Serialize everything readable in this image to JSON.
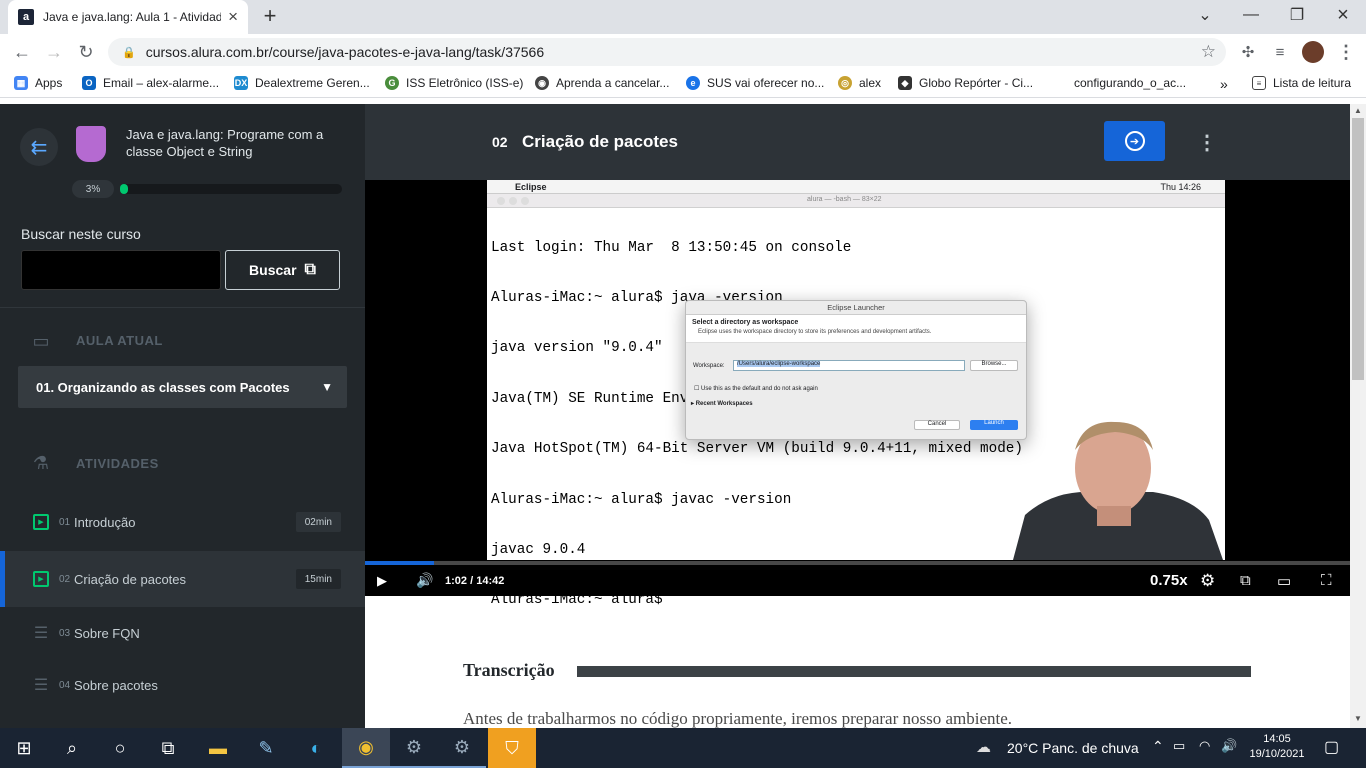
{
  "browser": {
    "tab_title": "Java e java.lang: Aula 1 - Atividad",
    "favicon_letter": "a",
    "url": "cursos.alura.com.br/course/java-pacotes-e-java-lang/task/37566",
    "bookmarks": [
      {
        "label": "Apps",
        "icon": "apps-grid-icon",
        "color": "#4285f4"
      },
      {
        "label": "Email – alex-alarme...",
        "icon": "outlook-icon",
        "color": "#0a64c2"
      },
      {
        "label": "Dealextreme Geren...",
        "icon": "dx-icon",
        "color": "#1e8bd0"
      },
      {
        "label": "ISS Eletrônico (ISS-e)",
        "icon": "globe-icon",
        "color": "#4a8d3c"
      },
      {
        "label": "Aprenda a cancelar...",
        "icon": "globe-icon",
        "color": "#444444"
      },
      {
        "label": "SUS vai oferecer no...",
        "icon": "globe-icon",
        "color": "#1a73e8"
      },
      {
        "label": "alex",
        "icon": "coin-icon",
        "color": "#c8a232"
      },
      {
        "label": "Globo Repórter - Ci...",
        "icon": "globo-icon",
        "color": "#333333"
      },
      {
        "label": "configurando_o_ac...",
        "icon": "",
        "color": ""
      }
    ],
    "reading_list": "Lista de leitura"
  },
  "sidebar": {
    "course_title": "Java e java.lang: Programe com a classe Object e String",
    "progress_label": "3%",
    "progress_value": 0.03,
    "search_label": "Buscar neste curso",
    "search_placeholder": "",
    "search_button": "Buscar",
    "current_lesson_heading": "AULA ATUAL",
    "current_lesson": "01. Organizando as classes com Pacotes",
    "activities_heading": "ATIVIDADES",
    "activities": [
      {
        "num": "01",
        "name": "Introdução",
        "duration": "02min",
        "type": "video",
        "active": false
      },
      {
        "num": "02",
        "name": "Criação de pacotes",
        "duration": "15min",
        "type": "video",
        "active": true
      },
      {
        "num": "03",
        "name": "Sobre FQN",
        "duration": "",
        "type": "list",
        "active": false
      },
      {
        "num": "04",
        "name": "Sobre pacotes",
        "duration": "",
        "type": "list",
        "active": false
      }
    ]
  },
  "lesson": {
    "number": "02",
    "title": "Criação de pacotes"
  },
  "video": {
    "current_time": "1:02",
    "separator": "/",
    "duration": "14:42",
    "progress_value": 0.07,
    "speed": "0.75x",
    "mac_app": "Eclipse",
    "mac_clock": "Thu 14:26",
    "terminal_title": "alura — -bash — 83×22",
    "terminal_lines": [
      "Last login: Thu Mar  8 13:50:45 on console",
      "Aluras-iMac:~ alura$ java -version",
      "java version \"9.0.4\"",
      "Java(TM) SE Runtime Environment (build 9.0.4+11)",
      "Java HotSpot(TM) 64-Bit Server VM (build 9.0.4+11, mixed mode)",
      "Aluras-iMac:~ alura$ javac -version",
      "javac 9.0.4",
      "Aluras-iMac:~ alura$ "
    ],
    "dialog": {
      "title": "Eclipse Launcher",
      "heading": "Select a directory as workspace",
      "description": "Eclipse uses the workspace directory to store its preferences and development artifacts.",
      "workspace_label": "Workspace:",
      "workspace_value": "/Users/alura/eclipse-workspace",
      "browse": "Browse...",
      "default_checkbox": "Use this as the default and do not ask again",
      "recent": "Recent Workspaces",
      "cancel": "Cancel",
      "launch": "Launch"
    }
  },
  "content": {
    "transcript_heading": "Transcrição",
    "transcript_text": "Antes de trabalharmos no código propriamente, iremos preparar nosso ambiente."
  },
  "taskbar": {
    "weather": "20°C  Panc. de chuva",
    "time": "14:05",
    "date": "19/10/2021"
  },
  "colors": {
    "accent": "#1565d8",
    "progress": "#00c86f",
    "sidebar_bg": "#22272b"
  }
}
